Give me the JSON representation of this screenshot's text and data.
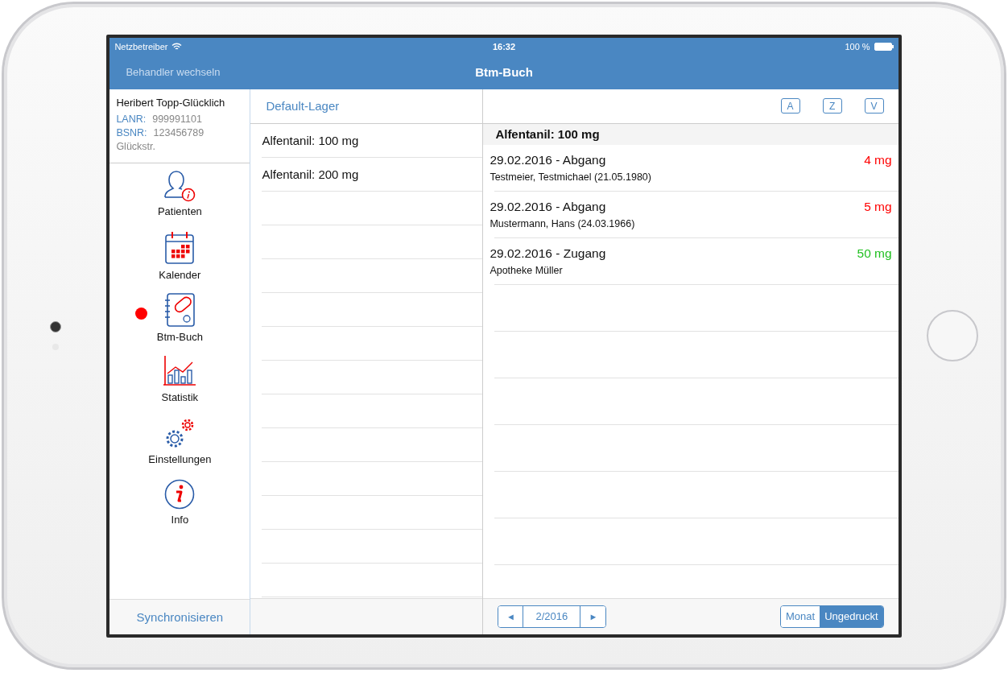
{
  "status_bar": {
    "carrier": "Netzbetreiber",
    "time": "16:32",
    "battery": "100 %"
  },
  "nav_bar": {
    "back": "Behandler wechseln",
    "title": "Btm-Buch"
  },
  "doctor": {
    "name": "Heribert Topp-Glücklich",
    "lanr_label": "LANR:",
    "lanr": "999991101",
    "bsnr_label": "BSNR:",
    "bsnr": "123456789",
    "street": "Glückstr."
  },
  "sidebar": {
    "items": [
      {
        "kind": "patients",
        "label": "Patienten",
        "badge": false
      },
      {
        "kind": "calendar",
        "label": "Kalender",
        "badge": false
      },
      {
        "kind": "book",
        "label": "Btm-Buch",
        "badge": true
      },
      {
        "kind": "stats",
        "label": "Statistik",
        "badge": false
      },
      {
        "kind": "settings",
        "label": "Einstellungen",
        "badge": false
      },
      {
        "kind": "info",
        "label": "Info",
        "badge": false
      }
    ],
    "sync": "Synchronisieren"
  },
  "storage": {
    "title": "Default-Lager",
    "items": [
      {
        "label": "Alfentanil: 100 mg"
      },
      {
        "label": "Alfentanil: 200 mg"
      }
    ]
  },
  "ledger": {
    "buttons": [
      "A",
      "Z",
      "V"
    ],
    "section": "Alfentanil: 100 mg",
    "entries": [
      {
        "title": "29.02.2016 - Abgang",
        "subtitle": "Testmeier, Testmichael (21.05.1980)",
        "amount": "4 mg",
        "color": "#ff0000"
      },
      {
        "title": "29.02.2016 - Abgang",
        "subtitle": "Mustermann, Hans (24.03.1966)",
        "amount": "5 mg",
        "color": "#ff0000"
      },
      {
        "title": "29.02.2016 - Zugang",
        "subtitle": "Apotheke Müller",
        "amount": "50 mg",
        "color": "#22c022"
      }
    ]
  },
  "footer": {
    "prev": "◄",
    "period": "2/2016",
    "next": "►",
    "segments": [
      {
        "label": "Monat",
        "selected": false
      },
      {
        "label": "Ungedruckt",
        "selected": true
      }
    ]
  }
}
